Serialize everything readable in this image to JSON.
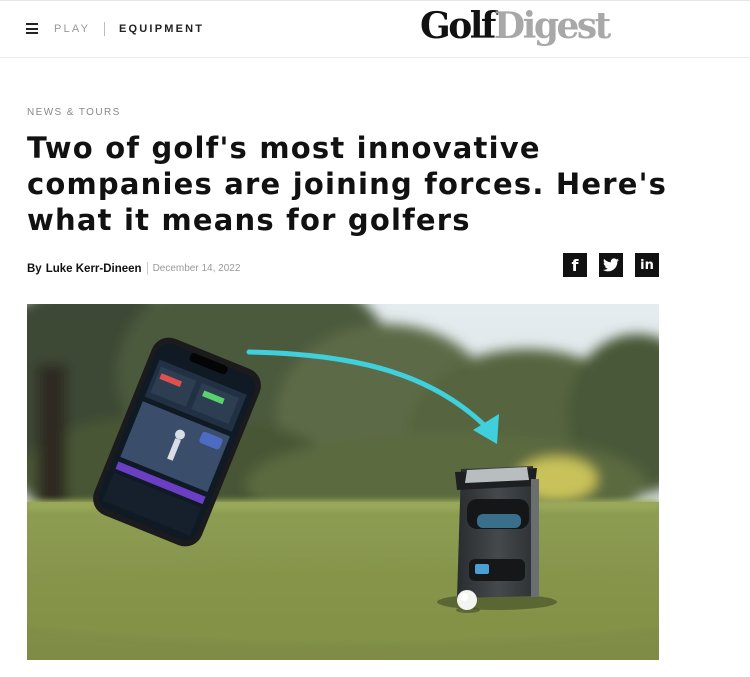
{
  "header": {
    "menu_icon": "hamburger-menu-icon",
    "nav": [
      {
        "label": "PLAY"
      },
      {
        "label": "EQUIPMENT"
      }
    ],
    "logo": {
      "part1": "Golf",
      "part2": "Digest"
    }
  },
  "article": {
    "kicker": "NEWS & TOURS",
    "title": "Two of golf's most innovative companies are joining forces. Here's what it means for golfers",
    "byline_prefix": "By",
    "author": "Luke Kerr-Dineen",
    "date": "December 14, 2022"
  },
  "share": {
    "facebook": {
      "glyph": "f",
      "icon": "facebook-icon"
    },
    "twitter": {
      "icon": "twitter-icon"
    },
    "linkedin": {
      "glyph": "in",
      "icon": "linkedin-icon"
    }
  },
  "hero": {
    "icons": [
      "smartphone-app-icon",
      "launch-monitor-icon",
      "golf-ball-icon",
      "arrow-icon"
    ],
    "colors": {
      "sky": "#dfe8ec",
      "grass": "#8a9a4a",
      "arrow": "#3fd0dc"
    }
  }
}
